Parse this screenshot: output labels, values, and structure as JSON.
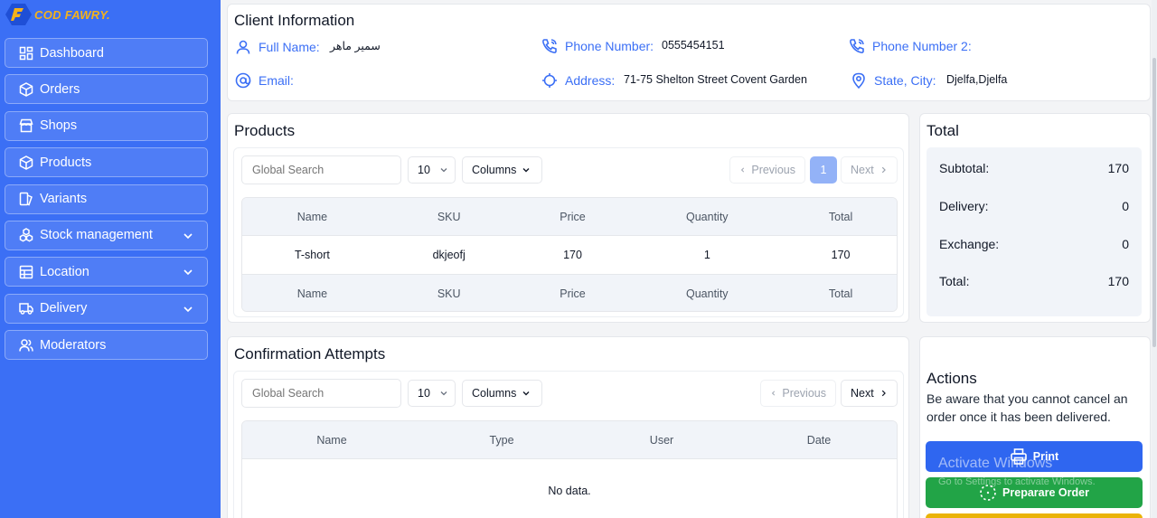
{
  "app": {
    "logo_text": "COD FAWRY",
    "logo_dot": "."
  },
  "sidebar": {
    "items": [
      {
        "label": "Dashboard",
        "icon": "dashboard-icon",
        "has_chevron": false
      },
      {
        "label": "Orders",
        "icon": "box-icon",
        "has_chevron": false
      },
      {
        "label": "Shops",
        "icon": "store-icon",
        "has_chevron": false
      },
      {
        "label": "Products",
        "icon": "box-icon",
        "has_chevron": false
      },
      {
        "label": "Variants",
        "icon": "variants-icon",
        "has_chevron": false
      },
      {
        "label": "Stock management",
        "icon": "stock-icon",
        "has_chevron": true
      },
      {
        "label": "Location",
        "icon": "location-icon",
        "has_chevron": true
      },
      {
        "label": "Delivery",
        "icon": "truck-icon",
        "has_chevron": true
      },
      {
        "label": "Moderators",
        "icon": "users-icon",
        "has_chevron": false
      }
    ]
  },
  "client": {
    "title": "Client Information",
    "full_name_label": "Full Name:",
    "full_name": "سمير ماهر",
    "phone_label": "Phone Number:",
    "phone": "0555454151",
    "phone2_label": "Phone Number 2:",
    "phone2": "",
    "email_label": "Email:",
    "email": "",
    "address_label": "Address:",
    "address": "71-75 Shelton Street Covent Garden",
    "state_label": "State, City:",
    "state": "Djelfa,Djelfa"
  },
  "products": {
    "title": "Products",
    "search_placeholder": "Global Search",
    "page_size": "10",
    "columns_label": "Columns",
    "prev_label": "Previous",
    "next_label": "Next",
    "current_page": "1",
    "headers": [
      "Name",
      "SKU",
      "Price",
      "Quantity",
      "Total"
    ],
    "rows": [
      [
        "T-short",
        "dkjeofj",
        "170",
        "1",
        "170"
      ]
    ],
    "footers": [
      "Name",
      "SKU",
      "Price",
      "Quantity",
      "Total"
    ]
  },
  "total": {
    "title": "Total",
    "subtotal_label": "Subtotal:",
    "subtotal": "170",
    "delivery_label": "Delivery:",
    "delivery": "0",
    "exchange_label": "Exchange:",
    "exchange": "0",
    "total_label": "Total:",
    "total": "170"
  },
  "confirmations": {
    "title": "Confirmation Attempts",
    "search_placeholder": "Global Search",
    "page_size": "10",
    "columns_label": "Columns",
    "prev_label": "Previous",
    "next_label": "Next",
    "headers": [
      "Name",
      "Type",
      "User",
      "Date"
    ],
    "empty_text": "No data."
  },
  "actions": {
    "title": "Actions",
    "warning": "Be aware that you cannot cancel an order once it has been delivered.",
    "print_label": "Print",
    "prepare_label": "Preparare Order"
  },
  "colors": {
    "sidebar": "#3b6ff5",
    "accent": "#3b6ff5",
    "print_button": "#2f66f0",
    "prepare_button": "#22a447",
    "warn_button": "#eab308"
  },
  "watermark": {
    "title": "Activate Windows",
    "subtitle": "Go to Settings to activate Windows."
  }
}
